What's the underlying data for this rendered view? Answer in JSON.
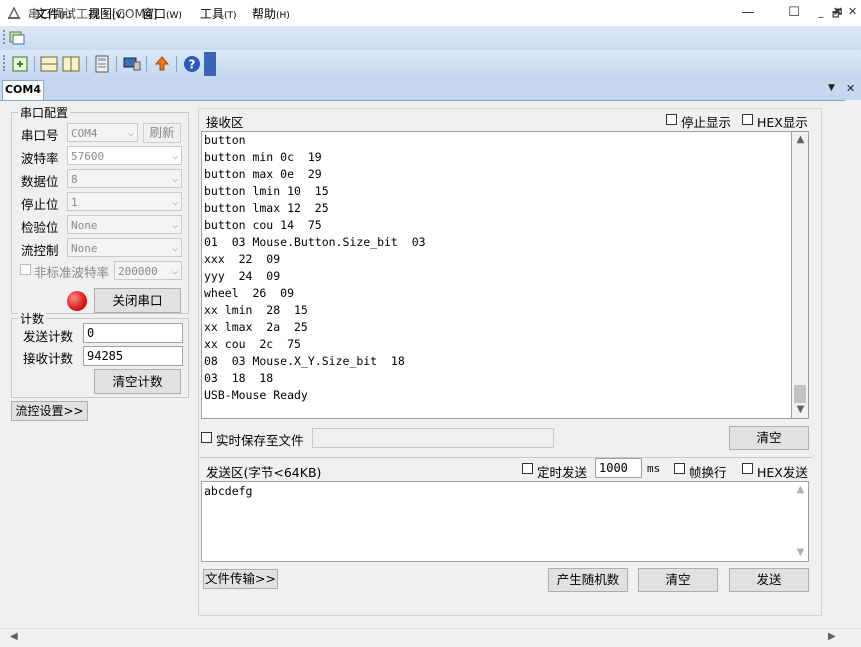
{
  "window": {
    "title": "串口调试工具 - [COM4]",
    "minimize": "—",
    "maximize": "☐",
    "close": "✕"
  },
  "menu": [
    {
      "label": "文件",
      "hotkey": "(F)"
    },
    {
      "label": "视图",
      "hotkey": "(V)"
    },
    {
      "label": "窗口",
      "hotkey": "(W)"
    },
    {
      "label": "工具",
      "hotkey": "(T)"
    },
    {
      "label": "帮助",
      "hotkey": "(H)"
    }
  ],
  "mdi_controls": {
    "minimize": "_",
    "restore": "🗗",
    "close": "✕"
  },
  "tab": {
    "label": "COM4",
    "dropdown": "▼",
    "close": "✕"
  },
  "port_config": {
    "group_label": "串口配置",
    "port_label": "串口号",
    "port_value": "COM4",
    "refresh_label": "刷新",
    "baud_label": "波特率",
    "baud_value": "57600",
    "databits_label": "数据位",
    "databits_value": "8",
    "stopbits_label": "停止位",
    "stopbits_value": "1",
    "parity_label": "检验位",
    "parity_value": "None",
    "flow_label": "流控制",
    "flow_value": "None",
    "nonstd_label": "非标准波特率",
    "nonstd_value": "200000",
    "close_port_label": "关闭串口",
    "status_color": "#e02020"
  },
  "counter": {
    "group_label": "计数",
    "send_label": "发送计数",
    "send_value": "0",
    "recv_label": "接收计数",
    "recv_value": "94285",
    "clear_label": "清空计数"
  },
  "flow_settings_label": "流控设置>>",
  "receive": {
    "label": "接收区",
    "stop_display_label": "停止显示",
    "hex_display_label": "HEX显示",
    "lines": [
      "button",
      "button min 0c  19",
      "button max 0e  29",
      "button lmin 10  15",
      "button lmax 12  25",
      "button cou 14  75",
      "01  03 Mouse.Button.Size_bit  03",
      "xxx  22  09",
      "yyy  24  09",
      "wheel  26  09",
      "xx lmin  28  15",
      "xx lmax  2a  25",
      "xx cou  2c  75",
      "08  03 Mouse.X_Y.Size_bit  18",
      "03  18  18",
      "USB-Mouse Ready"
    ],
    "save_to_file_label": "实时保存至文件",
    "file_path": "",
    "clear_label": "清空"
  },
  "send": {
    "label": "发送区(字节<64KB)",
    "timed_label": "定时发送",
    "interval_value": "1000",
    "interval_unit": "ms",
    "newline_label": "帧换行",
    "hex_send_label": "HEX发送",
    "text": "abcdefg",
    "file_transfer_label": "文件传输>>",
    "random_label": "产生随机数",
    "clear_label": "清空",
    "send_label": "发送"
  }
}
